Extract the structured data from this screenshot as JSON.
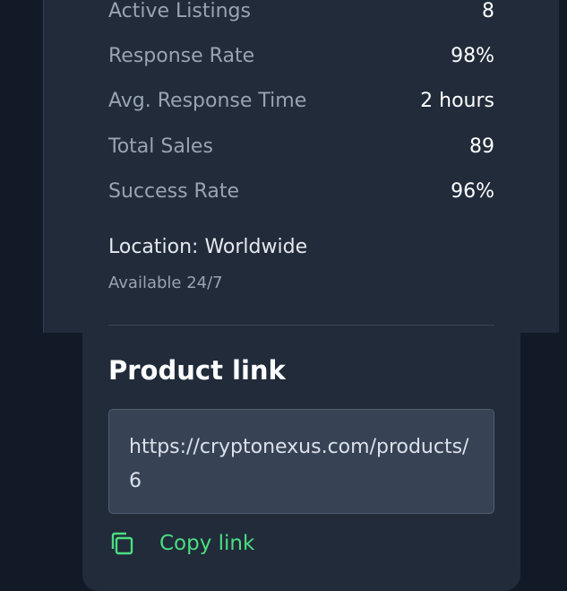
{
  "stats": [
    {
      "label": "Active Listings",
      "value": "8"
    },
    {
      "label": "Response Rate",
      "value": "98%"
    },
    {
      "label": "Avg. Response Time",
      "value": "2 hours"
    },
    {
      "label": "Total Sales",
      "value": "89"
    },
    {
      "label": "Success Rate",
      "value": "96%"
    }
  ],
  "location": "Location: Worldwide",
  "availability": "Available 24/7",
  "product_link": {
    "title": "Product link",
    "url": "https://cryptonexus.com/products/6",
    "copy_label": "Copy link",
    "copy_icon": "copy-icon"
  },
  "colors": {
    "accent": "#4bde80",
    "card": "#212b3a",
    "background": "#121a27",
    "input": "#384255"
  }
}
